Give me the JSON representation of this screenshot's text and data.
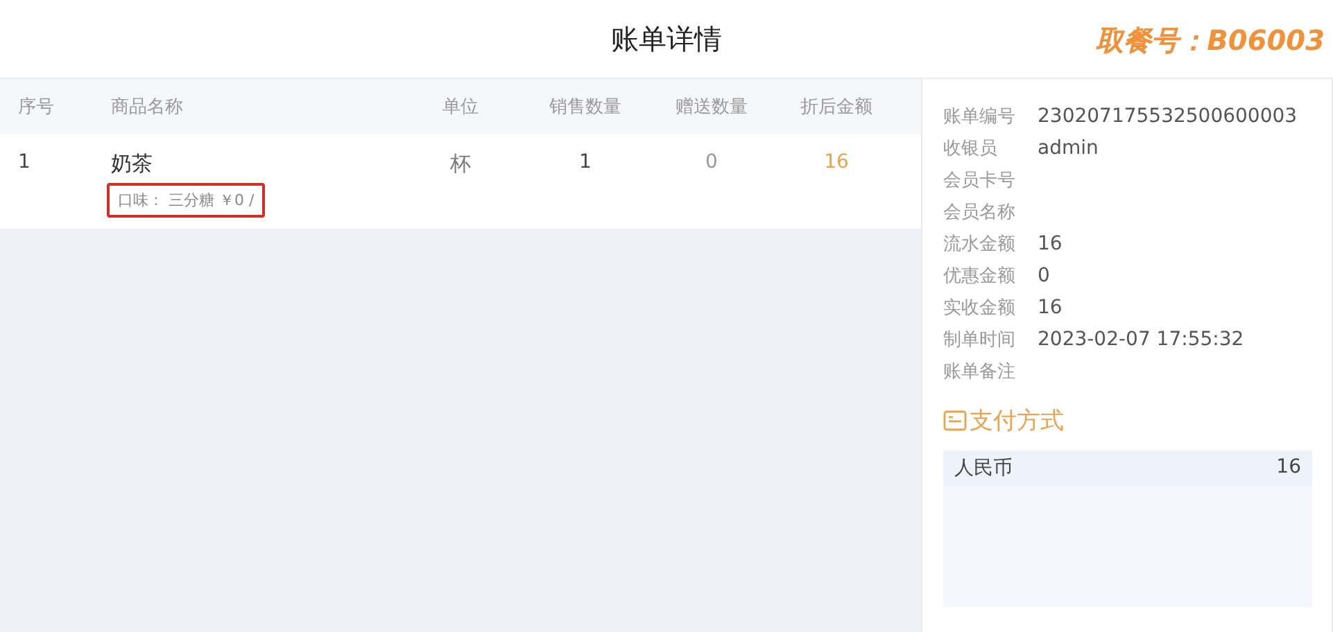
{
  "header": {
    "title": "账单详情",
    "pickup_number": "取餐号：B06003"
  },
  "table": {
    "columns": [
      "序号",
      "商品名称",
      "单位",
      "销售数量",
      "赠送数量",
      "折后金额"
    ],
    "rows": [
      {
        "index": "1",
        "name": "奶茶",
        "note": "口味： 三分糖 ￥0 /",
        "note_highlighted": true,
        "unit": "杯",
        "sold": "1",
        "gift": "0",
        "amount": "16"
      }
    ]
  },
  "bill_info": [
    {
      "label": "账单编号",
      "value": "230207175532500600003"
    },
    {
      "label": "收银员",
      "value": "admin"
    },
    {
      "label": "会员卡号"
    },
    {
      "label": "会员名称"
    },
    {
      "label": "流水金额",
      "value": "16"
    },
    {
      "label": "优惠金额",
      "value": "0"
    },
    {
      "label": "实收金额",
      "value": "16"
    },
    {
      "label": "制单时间",
      "value": "2023-02-07 17:55:32"
    },
    {
      "label": "账单备注"
    }
  ],
  "payment": {
    "title": "支付方式",
    "methods": [
      {
        "name": "人民币",
        "amount": "16"
      }
    ]
  }
}
